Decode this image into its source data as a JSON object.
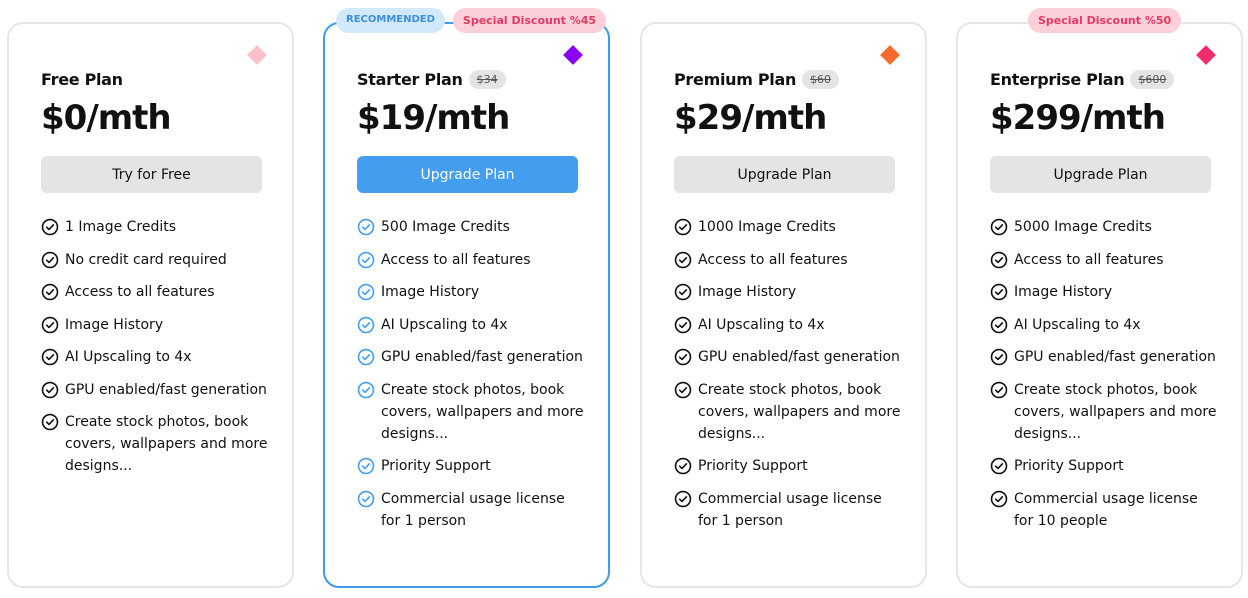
{
  "colors": {
    "accent_blue": "#449ef0",
    "discount_pink": "#e53a66",
    "neutral_button": "#e4e4e4"
  },
  "plans": [
    {
      "name": "Free Plan",
      "old_price": null,
      "price": "$0/mth",
      "cta": "Try for Free",
      "diamond_color": "#f9c0cc",
      "badges": [],
      "features": [
        "1 Image Credits",
        "No credit card required",
        "Access to all features",
        "Image History",
        "AI Upscaling to 4x",
        "GPU enabled/fast generation",
        "Create stock photos, book covers, wallpapers and more designs..."
      ]
    },
    {
      "name": "Starter Plan",
      "old_price": "$34",
      "price": "$19/mth",
      "cta": "Upgrade Plan",
      "diamond_color": "#8b00f5",
      "badges": [
        "RECOMMENDED",
        "Special Discount %45"
      ],
      "features": [
        "500 Image Credits",
        "Access to all features",
        "Image History",
        "AI Upscaling to 4x",
        "GPU enabled/fast generation",
        "Create stock photos, book covers, wallpapers and more designs...",
        "Priority Support",
        "Commercial usage license for 1 person"
      ]
    },
    {
      "name": "Premium Plan",
      "old_price": "$60",
      "price": "$29/mth",
      "cta": "Upgrade Plan",
      "diamond_color": "#f86a2d",
      "badges": [],
      "features": [
        "1000 Image Credits",
        "Access to all features",
        "Image History",
        "AI Upscaling to 4x",
        "GPU enabled/fast generation",
        "Create stock photos, book covers, wallpapers and more designs...",
        "Priority Support",
        "Commercial usage license for 1 person"
      ]
    },
    {
      "name": "Enterprise Plan",
      "old_price": "$600",
      "price": "$299/mth",
      "cta": "Upgrade Plan",
      "diamond_color": "#f22e6a",
      "badges": [
        "Special Discount %50"
      ],
      "features": [
        "5000 Image Credits",
        "Access to all features",
        "Image History",
        "AI Upscaling to 4x",
        "GPU enabled/fast generation",
        "Create stock photos, book covers, wallpapers and more designs...",
        "Priority Support",
        "Commercial usage license for 10 people"
      ]
    }
  ]
}
